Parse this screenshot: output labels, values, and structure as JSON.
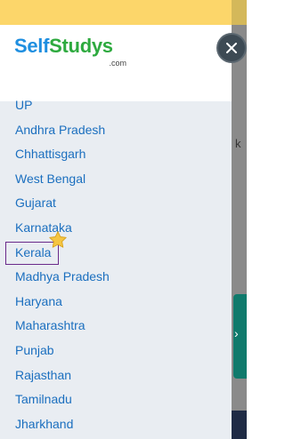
{
  "header": {
    "logo_self": "Self",
    "logo_studys": "Studys",
    "logo_sub": ".com",
    "close_icon": "close-icon"
  },
  "states": [
    {
      "label": "UP"
    },
    {
      "label": "Andhra Pradesh"
    },
    {
      "label": "Chhattisgarh"
    },
    {
      "label": "West Bengal"
    },
    {
      "label": "Gujarat"
    },
    {
      "label": "Karnataka"
    },
    {
      "label": "Kerala"
    },
    {
      "label": "Madhya Pradesh"
    },
    {
      "label": "Haryana"
    },
    {
      "label": "Maharashtra"
    },
    {
      "label": "Punjab"
    },
    {
      "label": "Rajasthan"
    },
    {
      "label": "Tamilnadu"
    },
    {
      "label": "Jharkhand"
    }
  ],
  "background": {
    "peek_letter": "k"
  },
  "colors": {
    "banner": "#fcd66a",
    "drawer_bg": "#e9edf2",
    "link": "#1b6fbf",
    "logo_blue": "#1f8fe0",
    "logo_green": "#2eaa3f",
    "highlight_border": "#6a2a8a",
    "star": "#f5c542"
  }
}
